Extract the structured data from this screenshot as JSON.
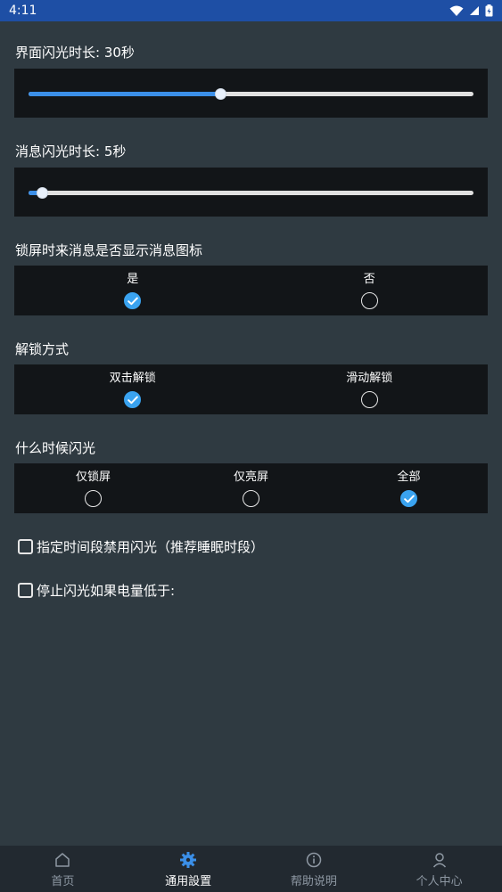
{
  "status_bar": {
    "time": "4:11"
  },
  "settings": {
    "screen_flash": {
      "label": "界面闪光时长: 30秒",
      "value_fraction": 0.43
    },
    "message_flash": {
      "label": "消息闪光时长: 5秒",
      "value_fraction": 0.03
    },
    "lockscreen_icon": {
      "label": "锁屏时来消息是否显示消息图标",
      "options": [
        {
          "label": "是",
          "checked": true
        },
        {
          "label": "否",
          "checked": false
        }
      ]
    },
    "unlock_method": {
      "label": "解锁方式",
      "options": [
        {
          "label": "双击解锁",
          "checked": true
        },
        {
          "label": "滑动解锁",
          "checked": false
        }
      ]
    },
    "when_flash": {
      "label": "什么时候闪光",
      "options": [
        {
          "label": "仅锁屏",
          "checked": false
        },
        {
          "label": "仅亮屏",
          "checked": false
        },
        {
          "label": "全部",
          "checked": true
        }
      ]
    },
    "disable_period": {
      "label": "指定时间段禁用闪光（推荐睡眠时段）",
      "checked": false
    },
    "stop_low_battery": {
      "label": "停止闪光如果电量低于:",
      "checked": false
    }
  },
  "bottom_nav": {
    "items": [
      {
        "label": "首页",
        "icon": "home-icon"
      },
      {
        "label": "通用設置",
        "icon": "settings-icon",
        "active": true
      },
      {
        "label": "帮助说明",
        "icon": "info-icon"
      },
      {
        "label": "个人中心",
        "icon": "profile-icon"
      }
    ]
  }
}
